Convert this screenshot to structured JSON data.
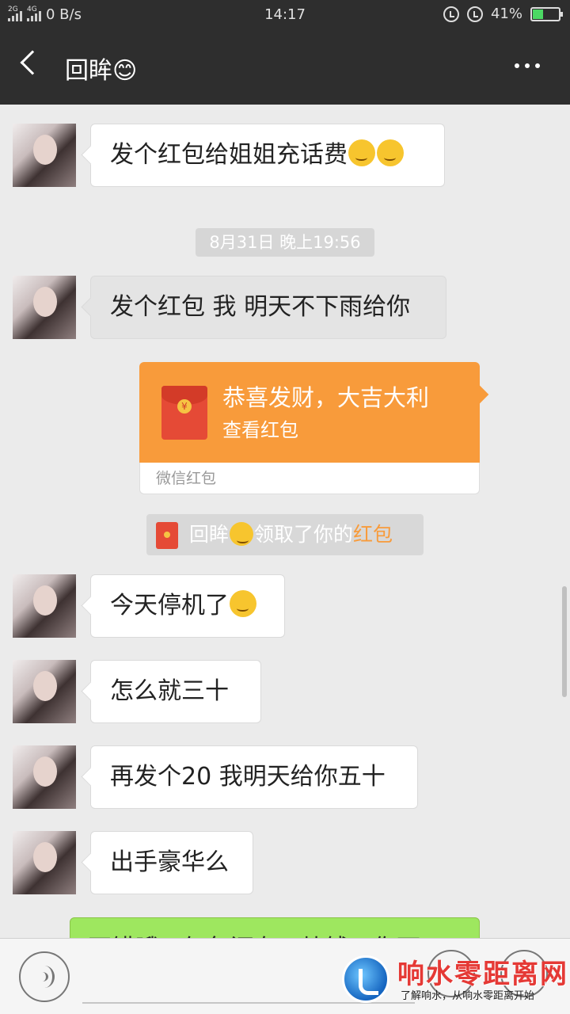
{
  "status_bar": {
    "network_left": "2G",
    "network_right": "4G",
    "speed": "0 B/s",
    "time": "14:17",
    "battery": "41%",
    "battery_level": 0.41
  },
  "header": {
    "title": "回眸😊"
  },
  "messages": [
    {
      "text": "发个红包给姐姐充话费",
      "emojis": 2
    },
    {
      "text": "发个红包 我 明天不下雨给你"
    },
    {
      "text": "今天停机了",
      "emojis": 1
    },
    {
      "text": "怎么就三十"
    },
    {
      "text": "再发个20 我明天给你五十"
    },
    {
      "text": "出手豪华么"
    }
  ],
  "timestamp": "8月31日 晚上19:56",
  "red_packet": {
    "title": "恭喜发财，大吉大利",
    "subtitle": "查看红包",
    "footer": "微信红包",
    "symbol": "¥"
  },
  "notice": {
    "prefix": "回眸",
    "middle": "领取了你的",
    "highlight": "红包"
  },
  "outgoing_partial": "不错哦，红包还有一块钱，你可",
  "watermark": {
    "name": "响水零距离网",
    "slogan": "了解响水，从响水零距离开始"
  },
  "colors": {
    "header_bg": "#2e2e2e",
    "red_packet": "#f89b3b",
    "outgoing_bubble": "#9ee75f"
  }
}
